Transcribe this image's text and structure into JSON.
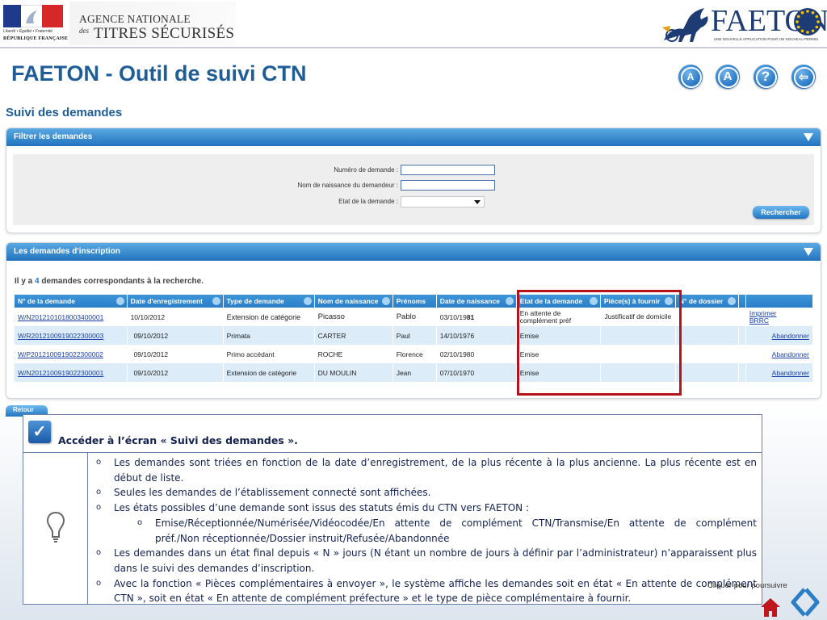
{
  "header": {
    "rf_motto": "Liberté • Égalité • Fraternité",
    "rf_name": "RÉPUBLIQUE FRANÇAISE",
    "ants_line1": "AGENCE NATIONALE",
    "ants_des": "des",
    "ants_line2": "TITRES SÉCURISÉS",
    "faeton_word": "FAETON",
    "faeton_tagline": "UNE NOUVELLE APPLICATION POUR UN NOUVEAU PERMIS"
  },
  "app_title": "FAETON - Outil de suivi CTN",
  "top_icons": {
    "font_decrease": "A",
    "font_increase": "A",
    "help": "?",
    "logout": "⇦"
  },
  "section_title": "Suivi des demandes",
  "filter_panel": {
    "title": "Filtrer les demandes",
    "fields": {
      "numero_label": "Numéro de demande :",
      "numero_value": "",
      "nom_label": "Nom de naissance du demandeur :",
      "nom_value": "",
      "etat_label": "Etat de la demande :",
      "etat_value": ""
    },
    "search_button": "Rechercher"
  },
  "results_panel": {
    "title": "Les demandes d'inscription",
    "count_prefix": "Il y a ",
    "count": "4",
    "count_suffix": " demandes correspondants à la recherche.",
    "columns": [
      "N° de la demande",
      "Date d'enregistrement",
      "Type de demande",
      "Nom de naissance",
      "Prénoms",
      "Date de naissance",
      "Etat de la demande",
      "Pièce(s) à fournir",
      "N° de dossier",
      "",
      ""
    ],
    "rows": [
      {
        "numero": "W/N2012101018003400001",
        "date_enreg": "10/10/2012",
        "type": "Extension de catégorie",
        "nom": "Picasso",
        "prenom": "Pablo",
        "date_naiss_a": "03/10/19",
        "date_naiss_b": "81",
        "etat": "En attente de complément préf",
        "pieces": "Justificatif de domicile",
        "dossier": "",
        "action1": "Imprimer",
        "action2": "BRRC"
      },
      {
        "numero": "W/R2012100919022300003",
        "date_enreg": "09/10/2012",
        "type": "Primata",
        "nom": "CARTER",
        "prenom": "Paul",
        "date_naiss_a": "14/10/1976",
        "date_naiss_b": "",
        "etat": "Emise",
        "pieces": "",
        "dossier": "",
        "action1": "Abandonner",
        "action2": ""
      },
      {
        "numero": "W/P2012100919022300002",
        "date_enreg": "09/10/2012",
        "type": "Primo accédant",
        "nom": "ROCHE",
        "prenom": "Florence",
        "date_naiss_a": "02/10/1980",
        "date_naiss_b": "",
        "etat": "Emise",
        "pieces": "",
        "dossier": "",
        "action1": "Abandonner",
        "action2": ""
      },
      {
        "numero": "W/N2012100919022300001",
        "date_enreg": "09/10/2012",
        "type": "Extension de catégorie",
        "nom": "DU MOULIN",
        "prenom": "Jean",
        "date_naiss_a": "07/10/1970",
        "date_naiss_b": "",
        "etat": "Emise",
        "pieces": "",
        "dossier": "",
        "action1": "Abandonner",
        "action2": ""
      }
    ]
  },
  "retour_button": "Retour",
  "info_box": {
    "title": "Accéder à l’écran « Suivi des demandes ».",
    "bullet": "o",
    "items": [
      "Les demandes sont triées en fonction de la date d’enregistrement, de la plus récente à la plus ancienne. La plus récente est en début de liste.",
      "Seules les demandes de l’établissement connecté sont affichées.",
      "Les états possibles d’une demande sont issus des statuts émis du CTN vers FAETON :",
      "Emise/Réceptionnée/Numérisée/Vidéocodée/En attente de complément CTN/Transmise/En attente de complément préf./Non réceptionnée/Dossier instruit/Refusée/Abandonnée",
      "Les demandes dans un état final depuis « N » jours (N étant un nombre de jours à définir par l’administrateur) n’apparaissent plus dans le suivi des demandes d’inscription.",
      "Avec la fonction « Pièces complémentaires à envoyer », le système affiche les demandes soit en état « En attente de complément CTN »,  soit  en état « En attente de complément préfecture »  et le type de pièce complémentaire à fournir."
    ]
  },
  "continue_note": "Cliquer pour poursuivre",
  "colors": {
    "title_blue": "#1f5d96",
    "header_blue": "#2a7ec7",
    "row_alt": "#dcecf9",
    "highlight_red": "#b5121b",
    "info_text": "#13214f"
  }
}
